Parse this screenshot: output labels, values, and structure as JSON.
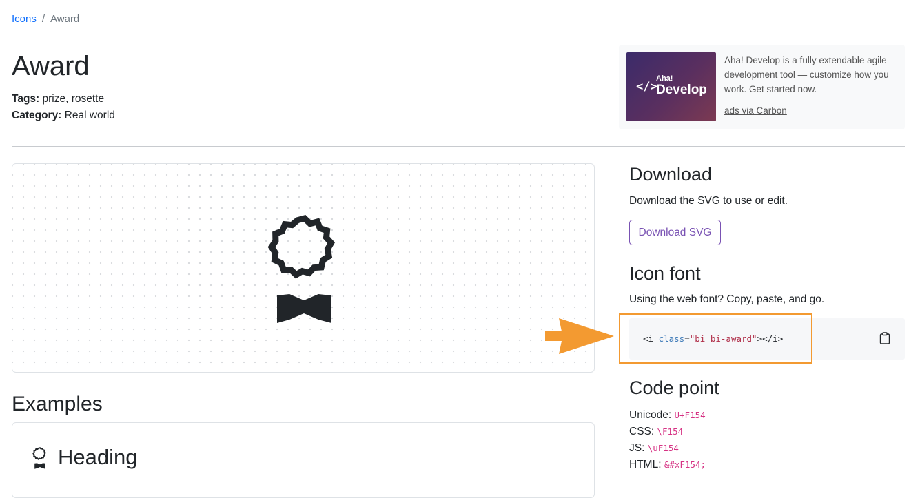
{
  "breadcrumb": {
    "root": "Icons",
    "separator": "/",
    "current": "Award"
  },
  "icon": {
    "title": "Award",
    "tags_label": "Tags:",
    "tags": "prize, rosette",
    "category_label": "Category:",
    "category": "Real world",
    "preview_icon": "award-icon"
  },
  "ad": {
    "brand_small": "Aha!",
    "brand_large": "Develop",
    "text": "Aha! Develop is a fully extendable agile development tool — customize how you work. Get started now.",
    "link": "ads via Carbon"
  },
  "examples": {
    "title": "Examples",
    "heading": "Heading"
  },
  "download": {
    "title": "Download",
    "description": "Download the SVG to use or edit.",
    "button": "Download SVG"
  },
  "icon_font": {
    "title": "Icon font",
    "description": "Using the web font? Copy, paste, and go.",
    "code_open": "<i ",
    "code_attr": "class",
    "code_eq": "=",
    "code_value": "\"bi bi-award\"",
    "code_close": "></i>",
    "copy_icon": "clipboard-icon"
  },
  "code_point": {
    "title": "Code point",
    "items": [
      {
        "label": "Unicode:",
        "value": "U+F154"
      },
      {
        "label": "CSS:",
        "value": "\\F154"
      },
      {
        "label": "JS:",
        "value": "\\uF154"
      },
      {
        "label": "HTML:",
        "value": "&#xF154;"
      }
    ]
  },
  "colors": {
    "accent": "#7952b3",
    "link": "#0d6efd",
    "highlight": "#f39a31",
    "code_pink": "#d63384"
  }
}
